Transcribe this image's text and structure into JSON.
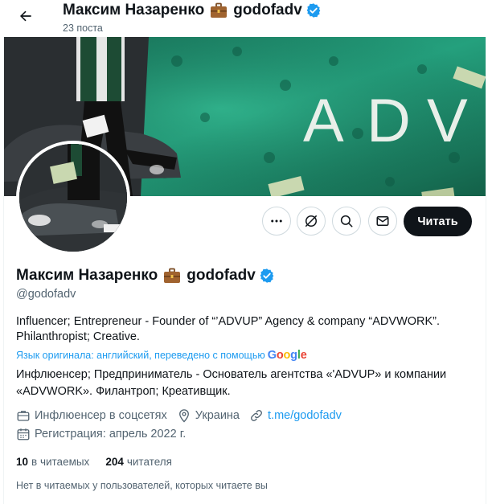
{
  "header": {
    "back_icon": "arrow-left-icon",
    "name": "Максим Назаренко",
    "handle_part": "godofadv",
    "posts_count": "23 поста"
  },
  "banner": {
    "text_letters": [
      "A",
      "D",
      "V"
    ]
  },
  "actions": {
    "more_icon": "more-horizontal-icon",
    "grok_icon": "grok-icon",
    "search_icon": "search-icon",
    "message_icon": "envelope-icon",
    "follow_label": "Читать"
  },
  "profile": {
    "name": "Максим Назаренко",
    "name_suffix": "godofadv",
    "handle": "@godofadv",
    "bio": "Influencer; Entrepreneur - Founder of “’ADVUP” Agency & company “ADVWORK”. Philanthropist; Creative.",
    "translate_note": "Язык оригинала: английский, переведено с помощью",
    "translate_brand": "Google",
    "bio_translated": "Инфлюенсер; Предприниматель - Основатель агентства «'ADVUP» и компании «ADVWORK». Филантроп; Креативщик.",
    "category": "Инфлюенсер в соцсетях",
    "location": "Украина",
    "website": "t.me/godofadv",
    "joined": "Регистрация: апрель 2022 г."
  },
  "stats": {
    "following_count": "10",
    "following_label": "в читаемых",
    "followers_count": "204",
    "followers_label": "читателя"
  },
  "note": "Нет в читаемых у пользователей, которых читаете вы",
  "colors": {
    "accent": "#1d9bf0",
    "banner_green": "#1f8c6c",
    "text_primary": "#0f1419",
    "text_secondary": "#536471"
  }
}
